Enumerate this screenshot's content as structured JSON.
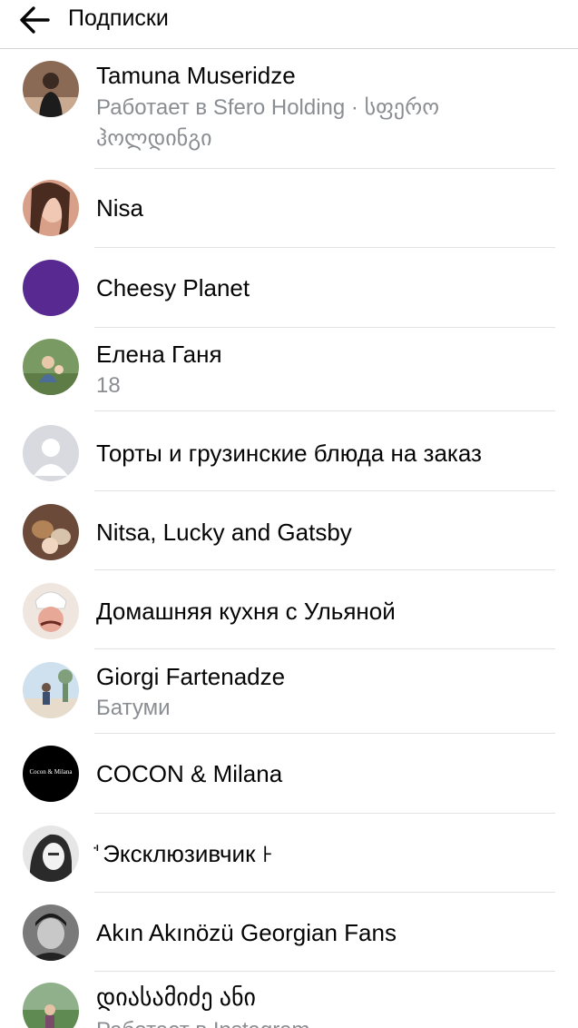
{
  "header": {
    "title": "Подписки",
    "back_icon": "arrow-left-icon"
  },
  "colors": {
    "separator": "#e2e2e2",
    "secondary_text": "#8a8d91",
    "placeholder_avatar": "#d8dadf",
    "cheesy_planet_avatar": "#582a91"
  },
  "subscriptions": [
    {
      "name": "Tamuna Museridze",
      "subtitle_line1": "Работает в Sfero Holding · სფერო",
      "subtitle_line2": "ჰოლდინგი",
      "avatar": "photo"
    },
    {
      "name": "Nisa",
      "avatar": "photo"
    },
    {
      "name": "Cheesy Planet",
      "avatar": "purple-circle"
    },
    {
      "name": "Елена Ганя",
      "subtitle": "18",
      "avatar": "photo"
    },
    {
      "name": "Торты и грузинские блюда на заказ",
      "avatar": "default-user-placeholder"
    },
    {
      "name": "Nitsa, Lucky and Gatsby",
      "avatar": "photo"
    },
    {
      "name": "Домашняя кухня с Ульяной",
      "avatar": "photo"
    },
    {
      "name": "Giorgi Fartenadze",
      "subtitle": "Батуми",
      "avatar": "photo"
    },
    {
      "name": "COCON & Milana",
      "avatar": "logo",
      "avatar_text": "Cocon & Milana"
    },
    {
      "name": "ꜗ Эксклюзивчик ꜔",
      "avatar": "photo"
    },
    {
      "name": "Akın Akınözü Georgian Fans",
      "avatar": "photo"
    },
    {
      "name": "დიასამიძე ანი",
      "subtitle": "Работает в Instagram",
      "avatar": "photo"
    }
  ]
}
